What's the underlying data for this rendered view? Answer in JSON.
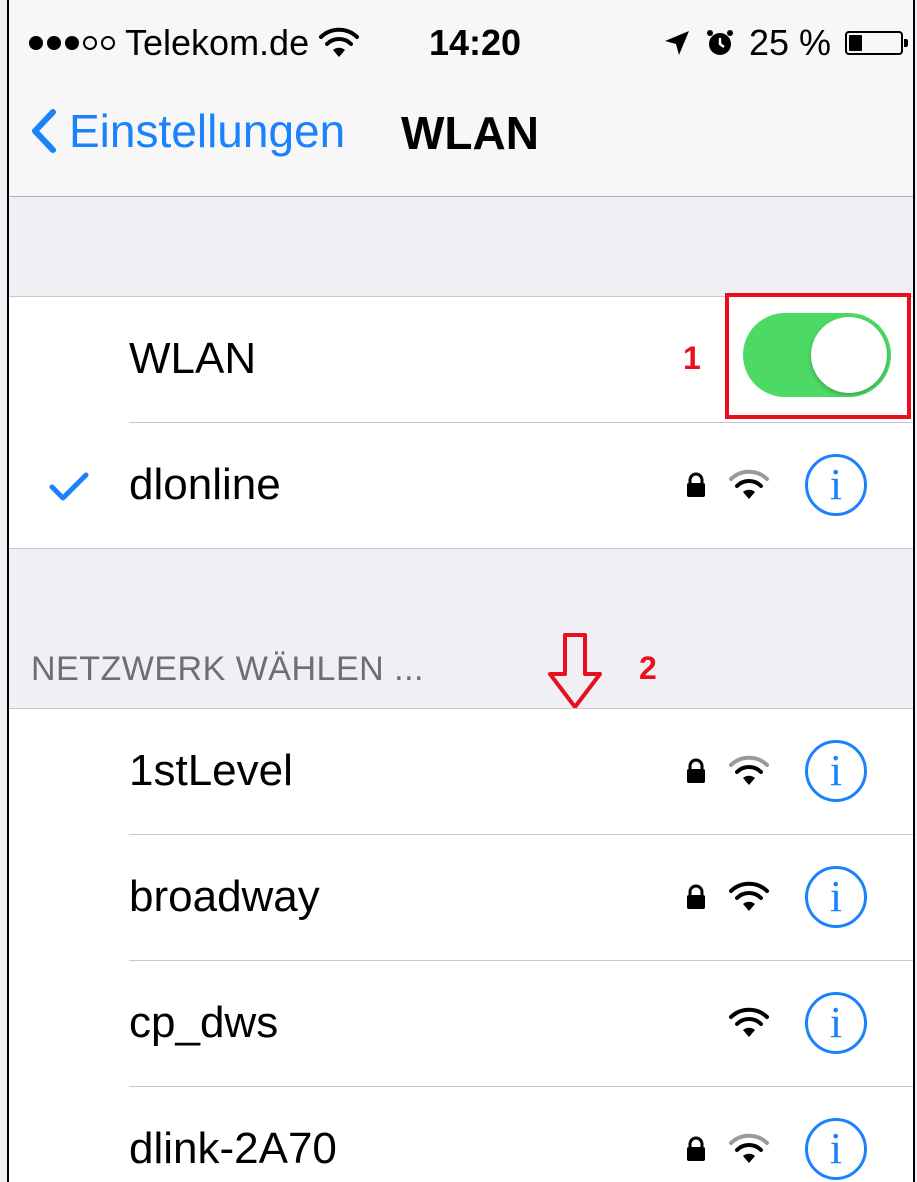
{
  "status_bar": {
    "signal_dots_filled": 3,
    "signal_dots_total": 5,
    "carrier": "Telekom.de",
    "time": "14:20",
    "battery_label": "25 %",
    "battery_level": 0.25,
    "icons": [
      "wifi-icon",
      "location-arrow-icon",
      "alarm-icon",
      "battery-icon"
    ]
  },
  "navbar": {
    "back_label": "Einstellungen",
    "title": "WLAN"
  },
  "wlan_toggle": {
    "label": "WLAN",
    "state": "on",
    "on_color": "#4cd964"
  },
  "connected_network": {
    "name": "dlonline",
    "secured": true,
    "selected": true
  },
  "choose_network": {
    "header": "NETZWERK WÄHLEN ..."
  },
  "networks": [
    {
      "name": "1stLevel",
      "secured": true
    },
    {
      "name": "broadway",
      "secured": true
    },
    {
      "name": "cp_dws",
      "secured": false
    },
    {
      "name": "dlink-2A70",
      "secured": true
    }
  ],
  "annotations": [
    {
      "number": "1",
      "color": "#e8101e"
    },
    {
      "number": "2",
      "color": "#e8101e"
    }
  ],
  "colors": {
    "accent": "#1a82fb",
    "annotation": "#e8101e",
    "toggle_on": "#4cd964"
  }
}
